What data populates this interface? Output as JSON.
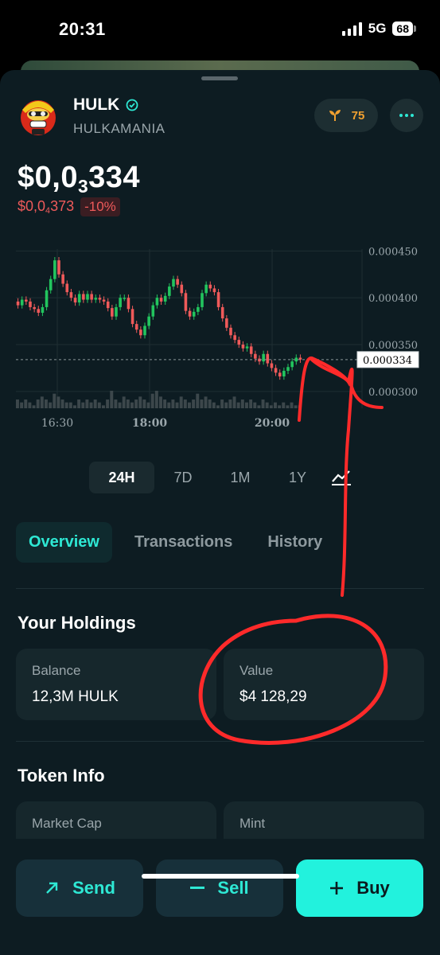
{
  "status_bar": {
    "time": "20:31",
    "network": "5G",
    "battery": "68"
  },
  "token": {
    "symbol": "HULK",
    "name": "HULKAMANIA",
    "verified_icon": "check-badge-icon"
  },
  "rank_pill": {
    "icon": "sprout-icon",
    "value": "75"
  },
  "price": {
    "main_prefix": "$0,0",
    "main_sub": "3",
    "main_suffix": "334",
    "change_prefix": "$0,0",
    "change_sub": "4",
    "change_suffix": "373",
    "change_pct": "-10%"
  },
  "chart_data": {
    "type": "candlestick",
    "y_ticks": [
      "0.000450",
      "0.000400",
      "0.000350",
      "0.000300"
    ],
    "x_ticks": [
      "16:30",
      "18:00",
      "20:00"
    ],
    "current_label": "0.000334",
    "ylim": [
      0.000282,
      0.000452
    ],
    "candles": [
      [
        0.000396,
        0.000392
      ],
      [
        0.000392,
        0.000398
      ],
      [
        0.000398,
        0.000396
      ],
      [
        0.000396,
        0.00039
      ],
      [
        0.00039,
        0.000388
      ],
      [
        0.000388,
        0.000384
      ],
      [
        0.000384,
        0.00039
      ],
      [
        0.00039,
        0.000408
      ],
      [
        0.000408,
        0.00042
      ],
      [
        0.00042,
        0.00044
      ],
      [
        0.00044,
        0.000425
      ],
      [
        0.000425,
        0.000415
      ],
      [
        0.000415,
        0.000406
      ],
      [
        0.000406,
        0.0004
      ],
      [
        0.0004,
        0.000395
      ],
      [
        0.000395,
        0.000404
      ],
      [
        0.000404,
        0.000398
      ],
      [
        0.000398,
        0.000404
      ],
      [
        0.000404,
        0.000398
      ],
      [
        0.000398,
        0.0004
      ],
      [
        0.0004,
        0.000398
      ],
      [
        0.000398,
        0.000396
      ],
      [
        0.000396,
        0.000389
      ],
      [
        0.000389,
        0.00038
      ],
      [
        0.00038,
        0.00039
      ],
      [
        0.00039,
        0.0004
      ],
      [
        0.0004,
        0.0004
      ],
      [
        0.0004,
        0.000388
      ],
      [
        0.000388,
        0.000372
      ],
      [
        0.000372,
        0.000366
      ],
      [
        0.000366,
        0.00036
      ],
      [
        0.00036,
        0.00037
      ],
      [
        0.00037,
        0.00038
      ],
      [
        0.00038,
        0.000392
      ],
      [
        0.000392,
        0.0004
      ],
      [
        0.0004,
        0.000396
      ],
      [
        0.000396,
        0.000402
      ],
      [
        0.000402,
        0.000412
      ],
      [
        0.000412,
        0.00042
      ],
      [
        0.00042,
        0.000414
      ],
      [
        0.000414,
        0.000405
      ],
      [
        0.000405,
        0.000386
      ],
      [
        0.000386,
        0.00038
      ],
      [
        0.00038,
        0.000385
      ],
      [
        0.000385,
        0.00039
      ],
      [
        0.00039,
        0.000405
      ],
      [
        0.000405,
        0.000414
      ],
      [
        0.000414,
        0.00041
      ],
      [
        0.00041,
        0.000406
      ],
      [
        0.000406,
        0.00039
      ],
      [
        0.00039,
        0.000378
      ],
      [
        0.000378,
        0.000368
      ],
      [
        0.000368,
        0.00036
      ],
      [
        0.00036,
        0.000355
      ],
      [
        0.000355,
        0.00035
      ],
      [
        0.00035,
        0.000346
      ],
      [
        0.000346,
        0.000348
      ],
      [
        0.000348,
        0.00034
      ],
      [
        0.00034,
        0.000335
      ],
      [
        0.000335,
        0.000332
      ],
      [
        0.000332,
        0.00034
      ],
      [
        0.00034,
        0.00033
      ],
      [
        0.00033,
        0.000325
      ],
      [
        0.000325,
        0.00032
      ],
      [
        0.00032,
        0.000316
      ],
      [
        0.000316,
        0.000322
      ],
      [
        0.000322,
        0.000326
      ],
      [
        0.000326,
        0.000332
      ],
      [
        0.000332,
        0.000336
      ],
      [
        0.000336,
        0.000334
      ]
    ],
    "volumes": [
      3,
      2,
      3,
      2,
      1,
      3,
      4,
      3,
      2,
      5,
      4,
      3,
      2,
      2,
      1,
      3,
      2,
      3,
      2,
      3,
      2,
      1,
      3,
      6,
      3,
      2,
      4,
      3,
      2,
      3,
      4,
      3,
      2,
      5,
      6,
      4,
      3,
      2,
      3,
      2,
      4,
      3,
      2,
      3,
      5,
      3,
      4,
      3,
      2,
      1,
      3,
      2,
      3,
      4,
      2,
      3,
      2,
      3,
      2,
      1,
      3,
      2,
      1,
      2,
      1,
      2,
      1,
      2,
      1,
      1
    ]
  },
  "ranges": [
    "24H",
    "7D",
    "1M",
    "1Y"
  ],
  "tabs": [
    "Overview",
    "Transactions",
    "History"
  ],
  "holdings": {
    "title": "Your Holdings",
    "balance_label": "Balance",
    "balance_value": "12,3M HULK",
    "value_label": "Value",
    "value_value": "$4 128,29"
  },
  "token_info": {
    "title": "Token Info",
    "market_cap_label": "Market Cap",
    "mint_label": "Mint"
  },
  "actions": {
    "send": "Send",
    "sell": "Sell",
    "buy": "Buy"
  },
  "colors": {
    "accent": "#22f2dd",
    "up": "#22c55e",
    "down": "#ef5a5a",
    "annotation": "#ff2a2a"
  }
}
